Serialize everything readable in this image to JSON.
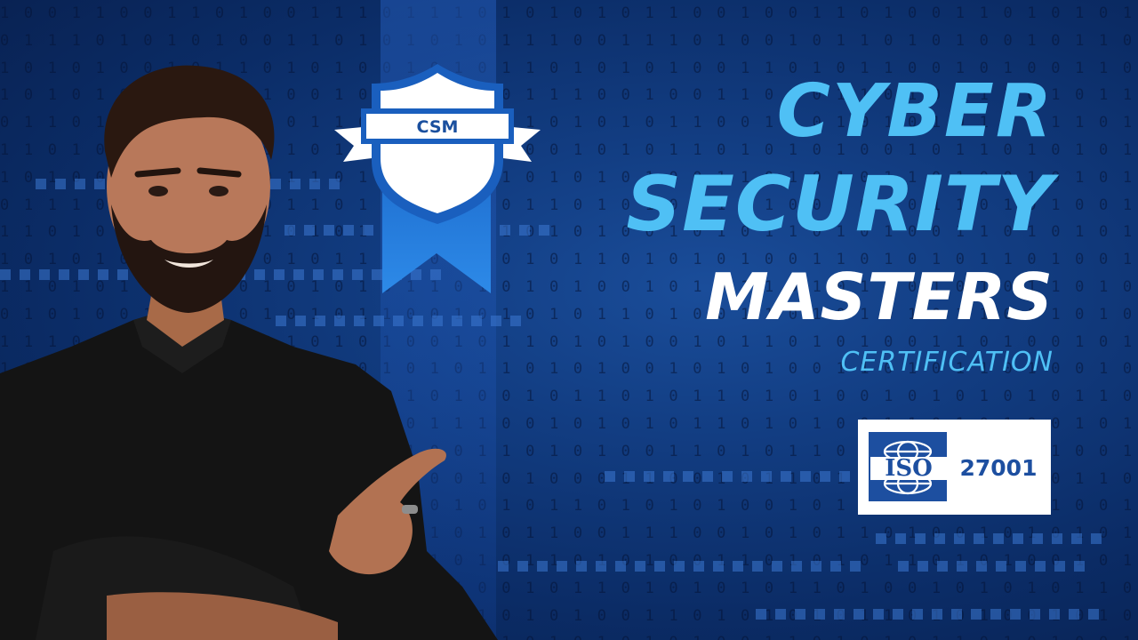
{
  "badge": {
    "label": "CSM"
  },
  "title": {
    "line1": "CYBER",
    "line2": "SECURITY",
    "line3": "MASTERS",
    "line4": "CERTIFICATION"
  },
  "iso": {
    "prefix": "ISO",
    "number": "27001"
  },
  "binary_rows": [
    "1 0 0 1 1 0 0 1 1 0 1 0 0 1 1 1 0 1 1 1 0 1 0 1 0 1 0 1 1 0 0 1 0 0 1 1 0 1 0 0 1 1 0 1 0 1 0 1 0 1",
    "0 1 1 1 0 1 0 1 0 1 0 0 1 1 0 1 0 1 0 1 0 1 1 1 0 0 1 1 1 0 1 0 0 1 0 1 1 0 1 0 1 0 0 1 0 1 1 0 1 0",
    "1 0 1 0 1 0 0 1 0 1 1 0 1 0 1 0 0 1 0 1 0 1 1 0 1 0 1 0 1 0 0 1 1 0 1 0 1 1 0 0 1 0 1 0 0 1 1 0 1 0",
    "1 0 1 0 1 0 1 0 1 1 0 1 0 0 1 0 1 0 0 1 1 0 1 1 1 0 0 1 0 0 1 1 0 1 0 1 1 0 1 0 0 1 1 0 1 0 1 1 0 1",
    "0 1 1 0 1 1 0 1 0 1 0 1 0 1 1 0 1 0 1 0 0 1 1 0 1 0 1 0 1 1 0 0 1 1 0 1 0 1 0 1 0 1 0 0 1 1 0 1 0 1",
    "1 1 0 1 0 1 0 0 1 1 0 0 1 0 1 0 1 1 0 1 0 1 0 0 1 0 1 0 1 1 0 1 0 1 0 1 0 0 1 0 1 1 0 1 0 1 0 1 1 0",
    "1 0 1 0 0 1 1 0 1 0 1 0 1 1 0 1 0 0 1 0 1 1 0 1 0 1 0 1 0 0 1 1 0 1 0 1 0 1 1 0 1 0 0 1 0 1 0 1 1 0",
    "0 1 1 1 0 1 0 1 0 0 1 0 1 1 0 1 0 1 0 1 0 0 1 1 0 1 0 1 0 1 1 0 1 0 0 1 0 1 0 1 1 0 1 0 1 0 0 1 1 0",
    "1 1 0 1 0 1 1 0 0 1 0 1 0 1 0 1 1 0 1 0 1 1 0 1 0 1 0 0 1 0 1 0 1 1 0 1 0 1 0 0 1 1 0 1 0 1 0 1 0 1",
    "1 0 1 0 1 0 0 1 1 0 1 0 1 0 1 1 0 1 0 1 0 0 1 0 1 1 0 1 0 1 0 1 0 0 1 1 0 1 0 1 0 1 1 0 1 0 0 1 0 1",
    "1 1 0 1 0 1 1 0 1 0 0 1 0 1 0 1 0 1 1 0 1 0 1 0 1 0 0 1 0 1 0 1 1 0 1 0 1 0 0 1 0 1 0 1 1 0 1 0 1 0",
    "0 1 0 1 0 0 1 1 0 1 0 1 0 1 0 1 1 0 0 1 0 1 0 1 0 1 1 0 1 0 0 1 1 0 1 0 1 0 1 0 1 1 0 0 1 0 1 0 1 1",
    "1 1 1 0 1 0 1 0 0 1 1 0 1 0 1 0 1 0 0 1 0 1 1 0 1 0 1 0 0 1 0 1 1 0 1 0 1 0 0 1 1 0 1 0 0 1 0 1 1 0",
    "1 0 1 1 1 0 0 1 1 0 1 0 0 1 1 0 1 0 1 0 1 1 0 1 0 1 0 0 1 0 1 0 1 0 0 1 1 0 1 0 1 1 0 1 0 0 1 0 1 0",
    "0 0 1 0 1 0 1 0 1 1 0 1 0 0 1 1 0 1 0 1 0 0 1 0 1 1 0 1 0 1 1 0 1 0 1 0 0 1 0 1 0 1 0 1 0 1 1 0 1 0",
    "1 1 0 0 1 0 1 0 1 1 1 0 0 1 0 1 1 0 1 1 1 0 0 1 0 1 0 1 0 1 1 0 1 0 1 0 0 1 1 0 1 0 1 0 0 1 0 1 1 0",
    "0 1 0 1 0 1 1 0 1 0 1 1 0 1 0 1 0 1 0 0 1 1 0 1 0 1 0 0 1 1 0 1 0 1 1 0 1 0 1 0 1 0 1 0 1 0 0 1 1 0",
    "1 0 0 1 0 1 0 1 0 1 0 1 1 0 0 1 0 1 0 0 1 0 1 0 0 0 1 1 0 0 1 0 1 1 0 1 0 1 0 1 0 1 1 0 0 1 1 0 0 1",
    "1 0 1 0 1 1 0 1 0 1 0 1 0 1 0 0 1 1 0 1 0 1 0 1 1 0 1 0 1 0 1 0 0 1 0 1 1 0 1 0 1 0 1 0 1 0 0 1 1 0",
    "0 1 0 1 1 0 1 0 1 0 0 1 0 1 0 1 0 0 1 0 1 0 1 1 0 0 1 1 1 0 0 1 0 1 0 1 1 0 1 0 0 1 0 1 0 1 0 1 0 1",
    "1 1 0 1 0 1 0 1 0 0 1 1 0 1 0 1 0 0 1 0 1 0 1 1 0 1 0 1 0 0 1 1 0 1 0 1 0 1 1 0 1 0 1 0 0 1 0 1 1 0",
    "1 0 1 0 1 0 0 1 1 0 1 0 1 1 0 1 0 1 0 1 0 0 1 0 1 1 0 1 0 1 0 1 0 1 1 0 1 0 0 1 0 1 0 1 0 1 1 0 1 0",
    "1 1 0 1 0 0 1 0 1 0 1 1 0 1 0 1 0 1 0 1 1 0 1 0 1 0 0 1 1 0 1 0 1 0 1 0 1 1 0 1 0 1 0 0 1 0 1 0 1 1",
    "0 1 0 1 0 1 0 0 1 1 0 1 0 1 0 0 1 0 1 0 1 1 0 1 0 1 0 1 0 1 0 0 1 1 0 1 0 1 0 1 1 0 1 0 1 0 0 1 0 1"
  ],
  "colors": {
    "background": "#123d82",
    "title_accent": "#4fc0f5",
    "title_white": "#ffffff",
    "iso_blue": "#1d4fa0"
  },
  "icons": {
    "badge": "shield-ribbon-badge-icon",
    "globe": "globe-icon",
    "person": "presenter-photo"
  }
}
